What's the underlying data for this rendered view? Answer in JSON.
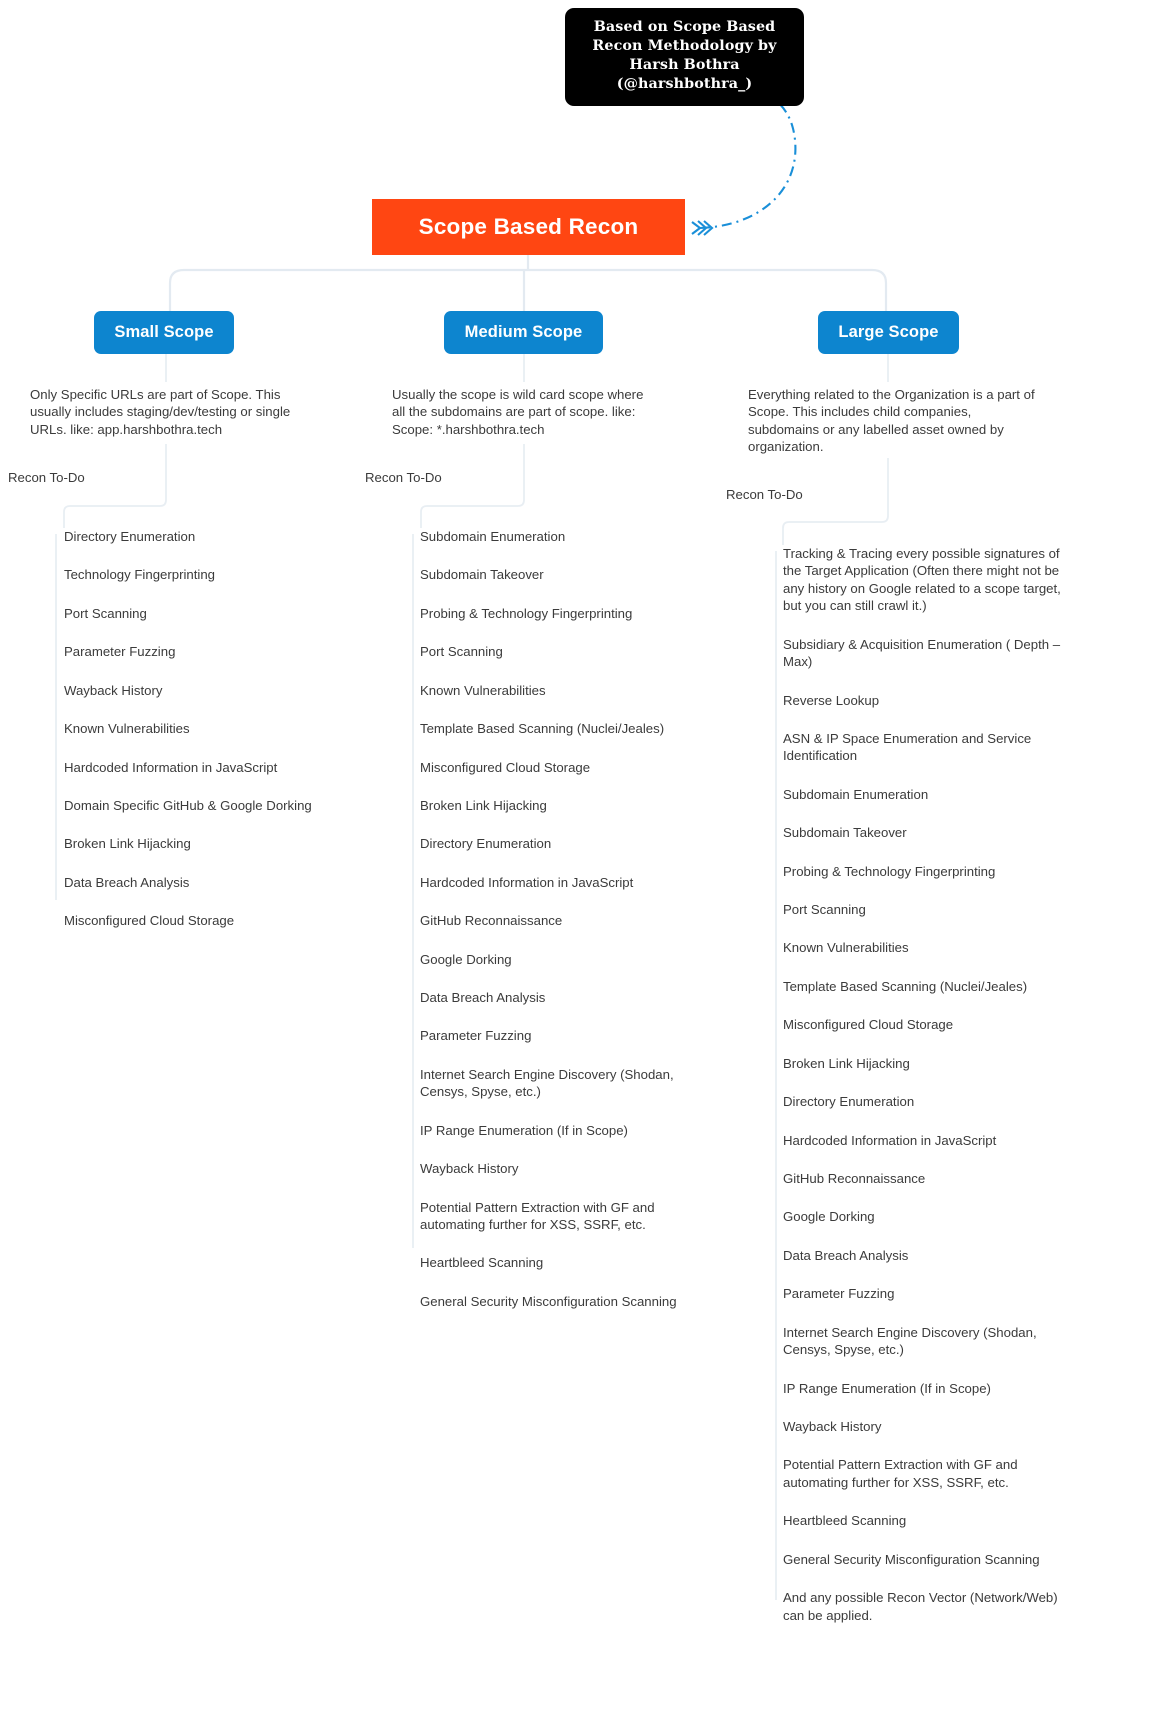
{
  "credit": {
    "text": "Based on Scope Based Recon Methodology by Harsh Bothra (@harshbothra_)"
  },
  "root": {
    "label": "Scope Based Recon",
    "color": "#ff4612"
  },
  "branch_color": "#0d85cf",
  "todo_label": "Recon To-Do",
  "branches": [
    {
      "id": "small",
      "label": "Small Scope",
      "description": "Only Specific URLs are part of Scope. This usually includes staging/dev/testing or single URLs. like: app.harshbothra.tech",
      "tasks": [
        "Directory Enumeration",
        "Technology Fingerprinting",
        "Port Scanning",
        "Parameter Fuzzing",
        "Wayback History",
        "Known Vulnerabilities",
        "Hardcoded Information in JavaScript",
        "Domain Specific GitHub & Google Dorking",
        "Broken Link Hijacking",
        "Data Breach Analysis",
        "Misconfigured Cloud Storage"
      ]
    },
    {
      "id": "medium",
      "label": "Medium Scope",
      "description": "Usually the scope is wild card scope where all the subdomains are part of scope. like: Scope: *.harshbothra.tech",
      "tasks": [
        "Subdomain Enumeration",
        "Subdomain Takeover",
        "Probing & Technology Fingerprinting",
        "Port Scanning",
        "Known Vulnerabilities",
        "Template Based Scanning (Nuclei/Jeales)",
        "Misconfigured Cloud Storage",
        "Broken Link Hijacking",
        "Directory Enumeration",
        "Hardcoded Information in JavaScript",
        "GitHub Reconnaissance",
        "Google Dorking",
        "Data Breach Analysis",
        "Parameter Fuzzing",
        "Internet Search Engine Discovery (Shodan, Censys, Spyse, etc.)",
        "IP Range Enumeration (If in Scope)",
        "Wayback History",
        "Potential Pattern Extraction with GF and automating further for XSS, SSRF, etc.",
        "Heartbleed Scanning",
        "General Security Misconfiguration Scanning"
      ]
    },
    {
      "id": "large",
      "label": "Large Scope",
      "description": "Everything related to the Organization is a part of Scope. This includes child companies, subdomains or any labelled asset owned by organization.",
      "tasks": [
        "Tracking & Tracing every possible signatures of the Target Application (Often there might not be any history on Google related to a scope target, but you can still crawl it.)",
        "Subsidiary & Acquisition Enumeration ( Depth – Max)",
        "Reverse Lookup",
        "ASN & IP Space Enumeration and Service Identification",
        "Subdomain Enumeration",
        "Subdomain Takeover",
        "Probing & Technology Fingerprinting",
        "Port Scanning",
        "Known Vulnerabilities",
        "Template Based Scanning (Nuclei/Jeales)",
        "Misconfigured Cloud Storage",
        "Broken Link Hijacking",
        "Directory Enumeration",
        "Hardcoded Information in JavaScript",
        "GitHub Reconnaissance",
        "Google Dorking",
        "Data Breach Analysis",
        "Parameter Fuzzing",
        "Internet Search Engine Discovery (Shodan, Censys, Spyse, etc.)",
        "IP Range Enumeration (If in Scope)",
        "Wayback History",
        "Potential Pattern Extraction with GF and automating further for XSS, SSRF, etc.",
        "Heartbleed Scanning",
        "General Security Misconfiguration Scanning",
        "And any possible Recon Vector (Network/Web) can be applied."
      ]
    }
  ]
}
